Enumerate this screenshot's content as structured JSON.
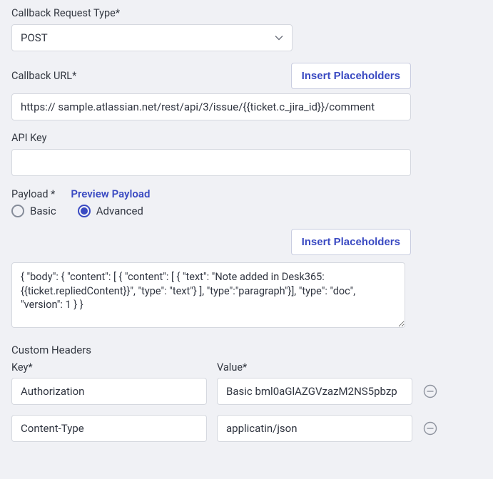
{
  "callbackType": {
    "label": "Callback Request Type*",
    "value": "POST"
  },
  "callbackUrl": {
    "label": "Callback URL*",
    "value": "https:// sample.atlassian.net/rest/api/3/issue/{{ticket.c_jira_id}}/comment"
  },
  "insertPlaceholders": "Insert Placeholders",
  "apiKey": {
    "label": "API Key",
    "value": ""
  },
  "payload": {
    "label": "Payload *",
    "preview": "Preview Payload",
    "options": {
      "basic": "Basic",
      "advanced": "Advanced"
    },
    "selected": "advanced",
    "body": "{ \"body\": { \"content\": [ { \"content\": [ { \"text\": \"Note added in Desk365: {{ticket.repliedContent}}\", \"type\": \"text\"} ], \"type\":\"paragraph\"}], \"type\": \"doc\", \"version\": 1 } }"
  },
  "customHeaders": {
    "label": "Custom Headers",
    "keyLabel": "Key*",
    "valueLabel": "Value*",
    "rows": [
      {
        "key": "Authorization",
        "value": "Basic bml0aGlAZGVzazM2NS5pbzp"
      },
      {
        "key": "Content-Type",
        "value": "applicatin/json"
      }
    ]
  }
}
